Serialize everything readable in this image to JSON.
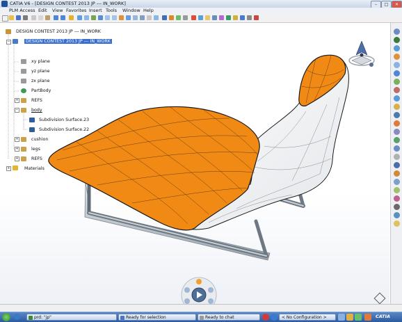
{
  "window": {
    "title": "CATIA V6 - [DESIGN CONTEST 2013 JP --- IN_WORK]",
    "minimize": "–",
    "maximize": "□",
    "close": "✕"
  },
  "menu": [
    "PLM Access",
    "Edit",
    "View",
    "Favorites",
    "Insert",
    "Tools",
    "Window",
    "Help"
  ],
  "tree": {
    "root": "DESIGN CONTEST 2013 JP --- IN_WORK",
    "child": "DESIGN CONTEST 2013 JP --- IN_WORK",
    "items": [
      {
        "label": "xy plane",
        "icon": "plane-icon"
      },
      {
        "label": "yz plane",
        "icon": "plane-icon"
      },
      {
        "label": "zx plane",
        "icon": "plane-icon"
      },
      {
        "label": "PartBody",
        "icon": "partbody-icon"
      },
      {
        "label": "REFS",
        "icon": "geometrical-set-icon"
      },
      {
        "label": "body",
        "icon": "geometrical-set-icon"
      },
      {
        "label": "Subdivision Surface.23",
        "icon": "subdivision-surface-icon"
      },
      {
        "label": "Subdivision Surface.22",
        "icon": "subdivision-surface-icon"
      },
      {
        "label": "cushion",
        "icon": "geometrical-set-icon"
      },
      {
        "label": "legs",
        "icon": "geometrical-set-icon"
      },
      {
        "label": "REFS",
        "icon": "geometrical-set-icon"
      },
      {
        "label": "Materials",
        "icon": "folder-icon"
      }
    ]
  },
  "status": {
    "ready_selection": "Ready for selection",
    "ready_chat": "Ready to chat",
    "configuration": "< No Configuration >"
  },
  "taskbar": {
    "task1": "prd: \"jp\"",
    "task2": "CATIA"
  },
  "colors": {
    "surface_orange": "#f08a14",
    "selection_blue": "#3a6fd0",
    "taskbar": "#2b5a9f"
  }
}
